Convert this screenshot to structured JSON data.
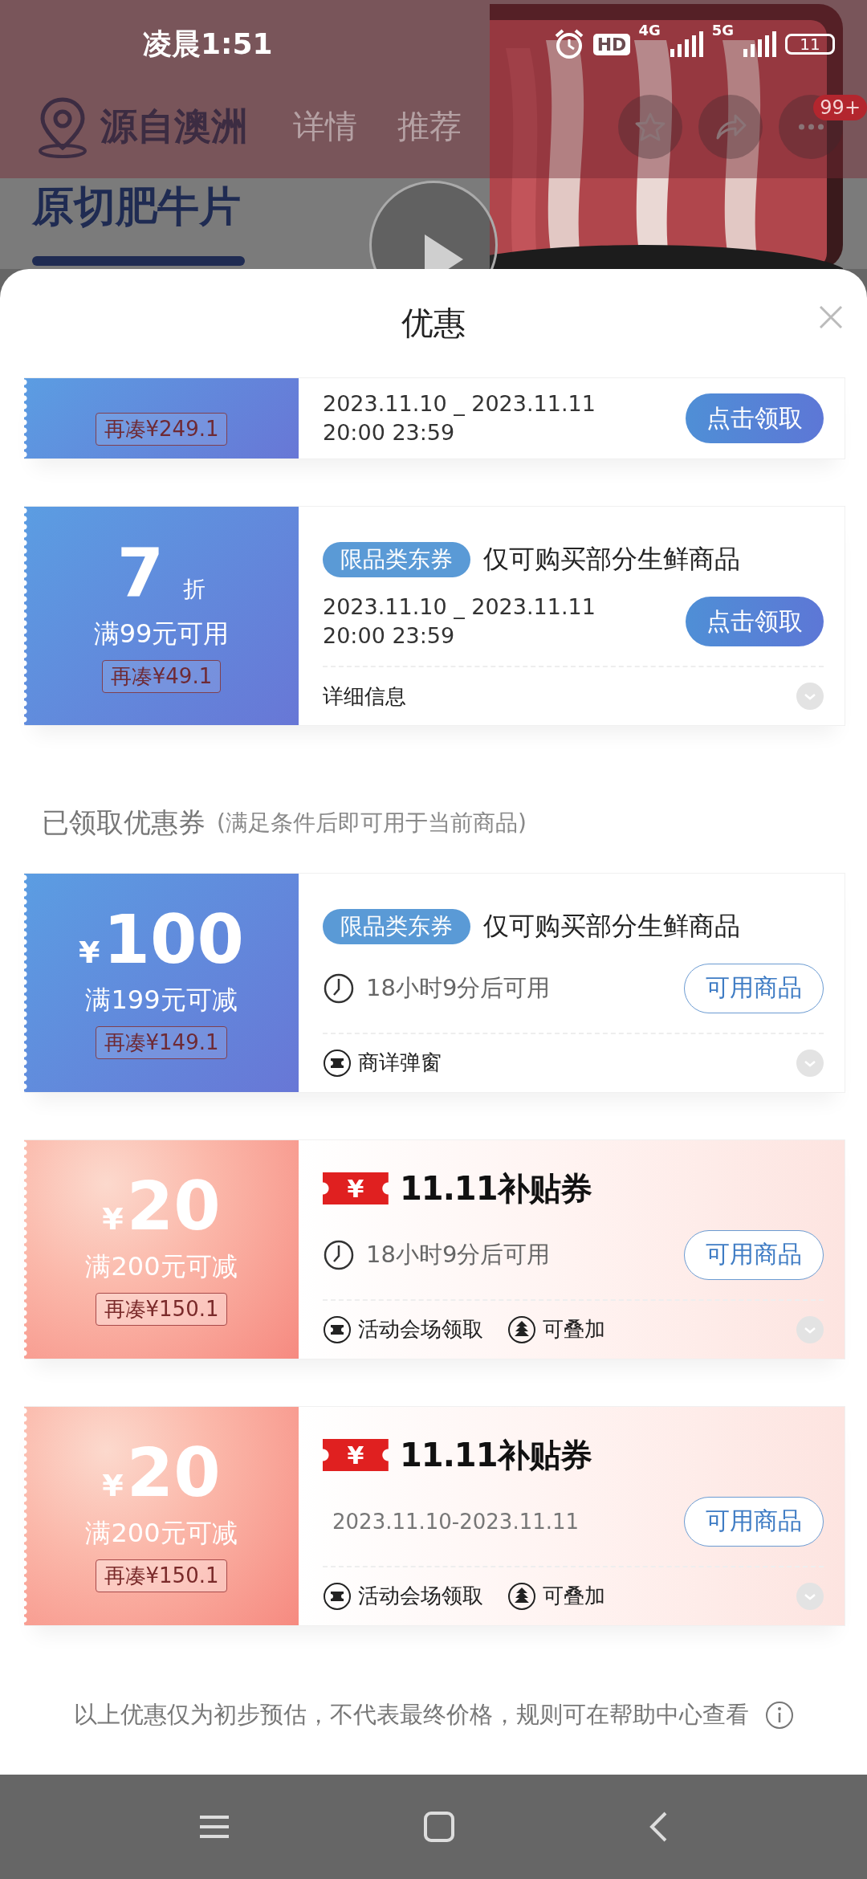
{
  "status_bar": {
    "time": "凌晨1:51",
    "hd_badge": "HD",
    "networks": [
      "4G",
      "5G"
    ],
    "battery": "11"
  },
  "product_page": {
    "brand": "源自澳洲",
    "nav_links": [
      "详情",
      "推荐"
    ],
    "more_badge": "99+",
    "title": "原切肥牛片"
  },
  "coupon_sheet": {
    "title": "优惠",
    "offers": [
      {
        "kind": "plain",
        "clipped": true,
        "gap": "再凑¥249.1",
        "validity": [
          "2023.11.10 _ 2023.11.11",
          "20:00 23:59"
        ],
        "button": {
          "label": "点击领取",
          "kind": "claim"
        }
      },
      {
        "kind": "plain",
        "clipped": false,
        "value": "7",
        "unit": "折",
        "condition": "满99元可用",
        "gap": "再凑¥49.1",
        "tag": "限品类东券",
        "description": "仅可购买部分生鲜商品",
        "validity": [
          "2023.11.10 _ 2023.11.11",
          "20:00 23:59"
        ],
        "button": {
          "label": "点击领取",
          "kind": "claim"
        },
        "details": [
          {
            "kind": "text",
            "text": "详细信息"
          }
        ]
      }
    ],
    "claimed_section": {
      "title": "已领取优惠券",
      "note": "(满足条件后即可用于当前商品)"
    },
    "claimed": [
      {
        "kind": "plain",
        "clipped": false,
        "currency": "¥",
        "value": "100",
        "condition": "满199元可减",
        "gap": "再凑¥149.1",
        "tag": "限品类东券",
        "description": "仅可购买部分生鲜商品",
        "countdown": "18小时9分后可用",
        "button": {
          "label": "可用商品",
          "kind": "outline"
        },
        "details": [
          {
            "kind": "ticket",
            "text": "商详弹窗"
          }
        ]
      },
      {
        "kind": "subsidy",
        "clipped": false,
        "currency": "¥",
        "value": "20",
        "condition": "满200元可减",
        "gap": "再凑¥150.1",
        "logo": {
          "badge": "¥",
          "text": "11.11补贴券"
        },
        "countdown": "18小时9分后可用",
        "button": {
          "label": "可用商品",
          "kind": "outline"
        },
        "details": [
          {
            "kind": "ticket",
            "text": "活动会场领取"
          },
          {
            "kind": "stack",
            "text": "可叠加"
          }
        ]
      },
      {
        "kind": "subsidy",
        "clipped": false,
        "currency": "¥",
        "value": "20",
        "condition": "满200元可减",
        "gap": "再凑¥150.1",
        "logo": {
          "badge": "¥",
          "text": "11.11补贴券"
        },
        "date_range": "2023.11.10-2023.11.11",
        "button": {
          "label": "可用商品",
          "kind": "outline"
        },
        "details": [
          {
            "kind": "ticket",
            "text": "活动会场领取"
          },
          {
            "kind": "stack",
            "text": "可叠加"
          }
        ]
      }
    ],
    "disclaimer": "以上优惠仅为初步预估，不代表最终价格，规则可在帮助中心查看"
  }
}
